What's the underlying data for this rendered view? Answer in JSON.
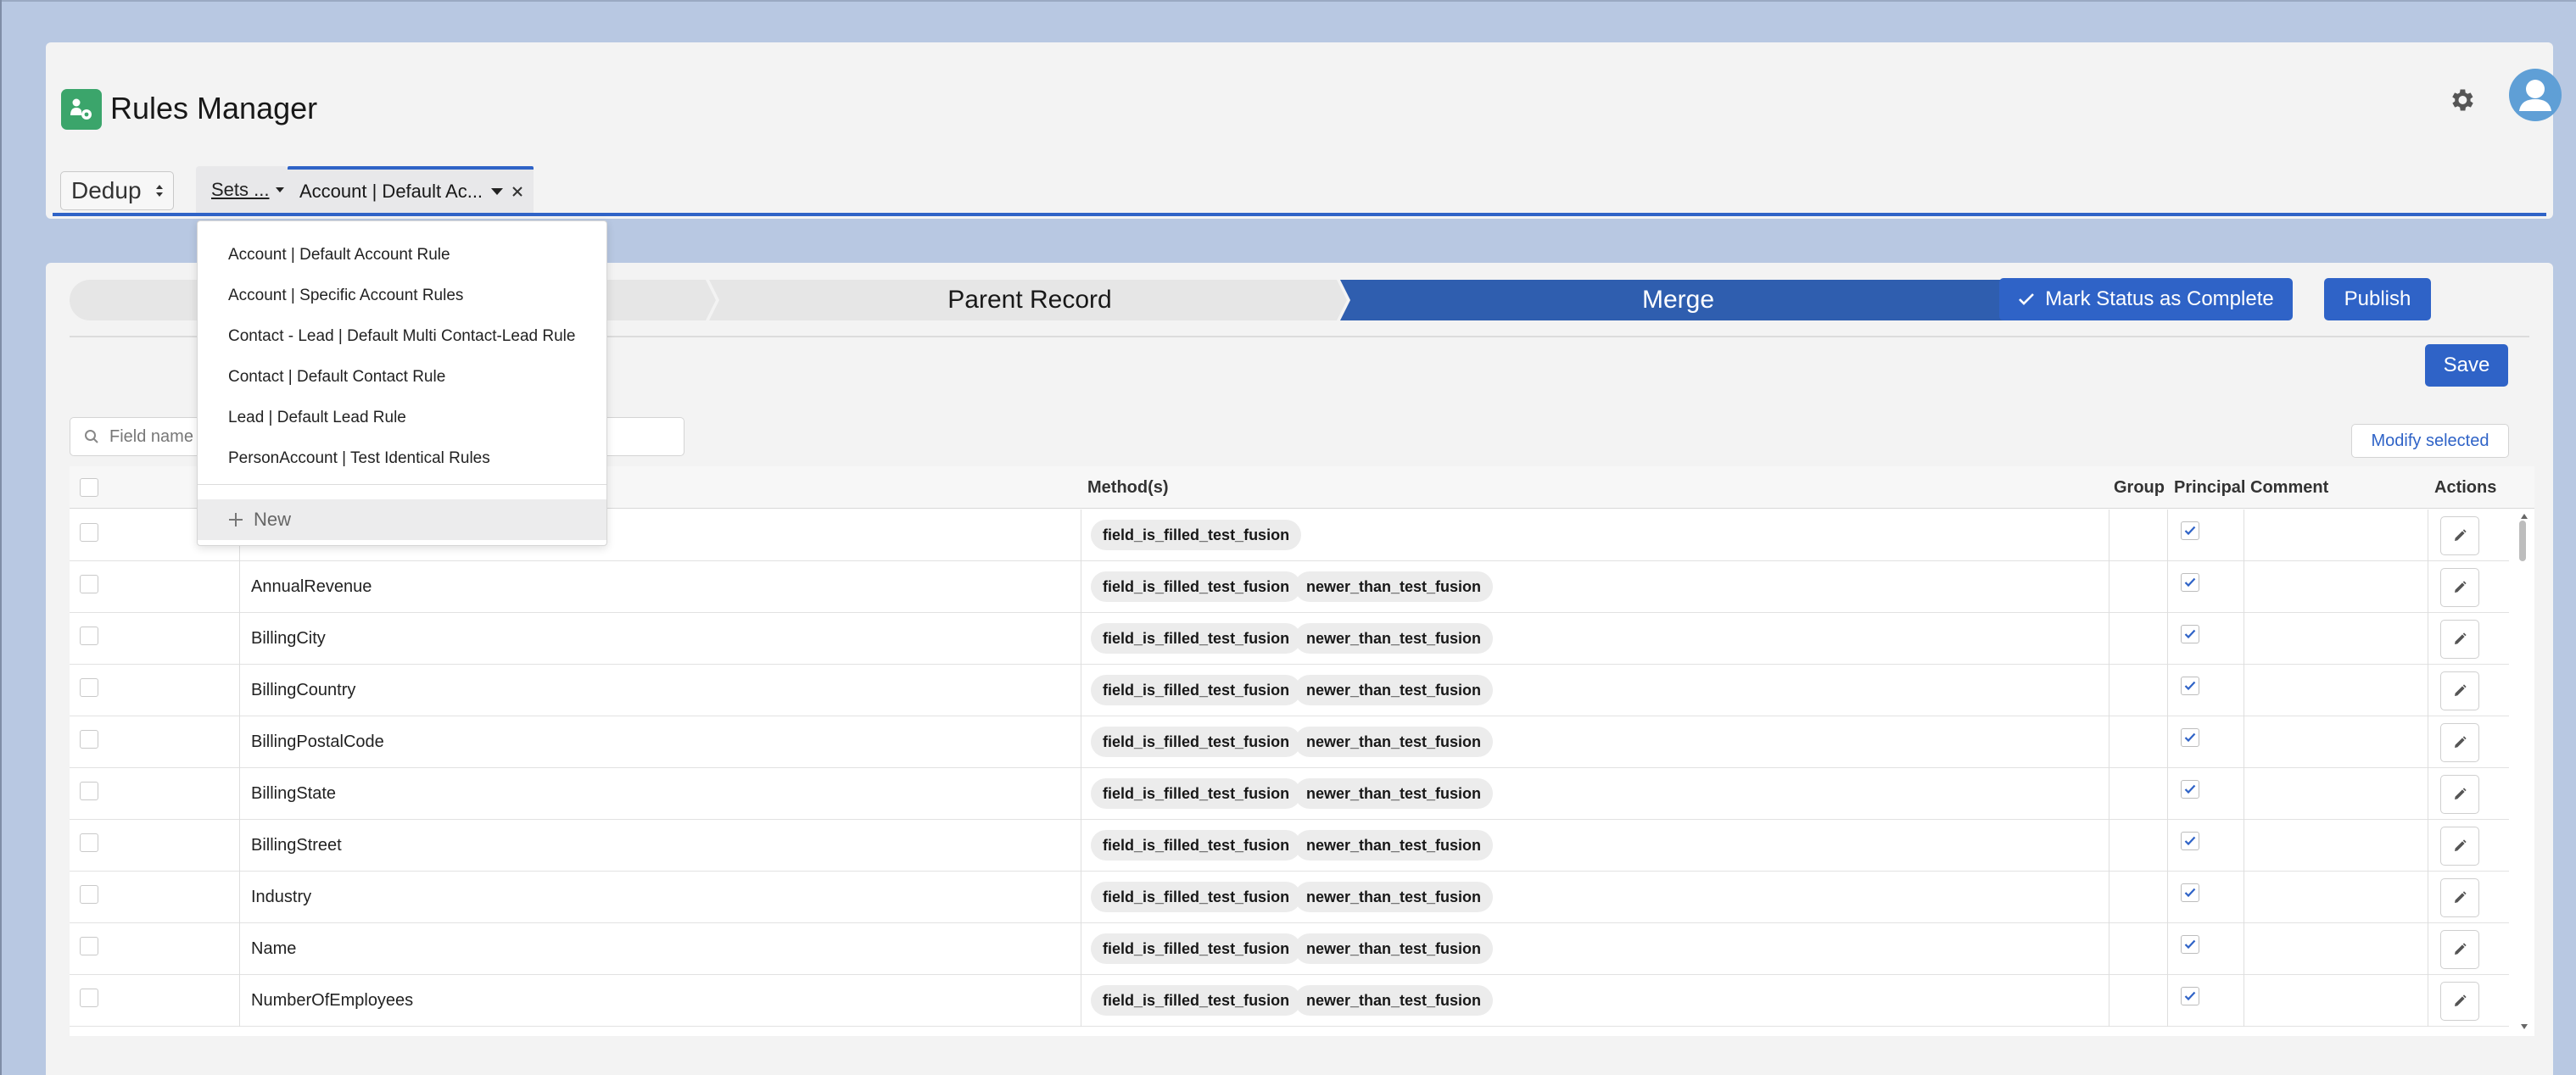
{
  "app": {
    "title": "Rules Manager",
    "mode": "Dedup",
    "icons": {
      "app": "rules-app-icon",
      "settings": "gear-icon",
      "user": "avatar-icon"
    }
  },
  "tabs": {
    "sets_label": "Sets ...",
    "active_label": "Account | Default Ac..."
  },
  "dropdown": {
    "items": [
      "Account | Default Account Rule",
      "Account | Specific Account Rules",
      "Contact - Lead | Default Multi Contact-Lead Rule",
      "Contact | Default Contact Rule",
      "Lead | Default Lead Rule",
      "PersonAccount | Test Identical Rules"
    ],
    "new_label": "New"
  },
  "path": {
    "steps": [
      "",
      "Parent Record",
      "Merge"
    ],
    "current": "Merge"
  },
  "buttons": {
    "mark_complete": "Mark Status as Complete",
    "publish": "Publish",
    "save": "Save",
    "modify_selected": "Modify selected"
  },
  "search": {
    "placeholder": "Field name"
  },
  "table": {
    "headers": {
      "methods": "Method(s)",
      "group": "Group",
      "principal": "Principal",
      "comment": "Comment",
      "actions": "Actions"
    },
    "rows": [
      {
        "field": "",
        "methods": [
          "field_is_filled_test_fusion"
        ]
      },
      {
        "field": "AnnualRevenue",
        "methods": [
          "field_is_filled_test_fusion",
          "newer_than_test_fusion"
        ]
      },
      {
        "field": "BillingCity",
        "methods": [
          "field_is_filled_test_fusion",
          "newer_than_test_fusion"
        ]
      },
      {
        "field": "BillingCountry",
        "methods": [
          "field_is_filled_test_fusion",
          "newer_than_test_fusion"
        ]
      },
      {
        "field": "BillingPostalCode",
        "methods": [
          "field_is_filled_test_fusion",
          "newer_than_test_fusion"
        ]
      },
      {
        "field": "BillingState",
        "methods": [
          "field_is_filled_test_fusion",
          "newer_than_test_fusion"
        ]
      },
      {
        "field": "BillingStreet",
        "methods": [
          "field_is_filled_test_fusion",
          "newer_than_test_fusion"
        ]
      },
      {
        "field": "Industry",
        "methods": [
          "field_is_filled_test_fusion",
          "newer_than_test_fusion"
        ]
      },
      {
        "field": "Name",
        "methods": [
          "field_is_filled_test_fusion",
          "newer_than_test_fusion"
        ]
      },
      {
        "field": "NumberOfEmployees",
        "methods": [
          "field_is_filled_test_fusion",
          "newer_than_test_fusion"
        ]
      }
    ]
  },
  "colors": {
    "accent": "#2f63c7",
    "app_icon": "#3ba56b",
    "avatar": "#5f9fd6",
    "background": "#b8c8e2"
  }
}
